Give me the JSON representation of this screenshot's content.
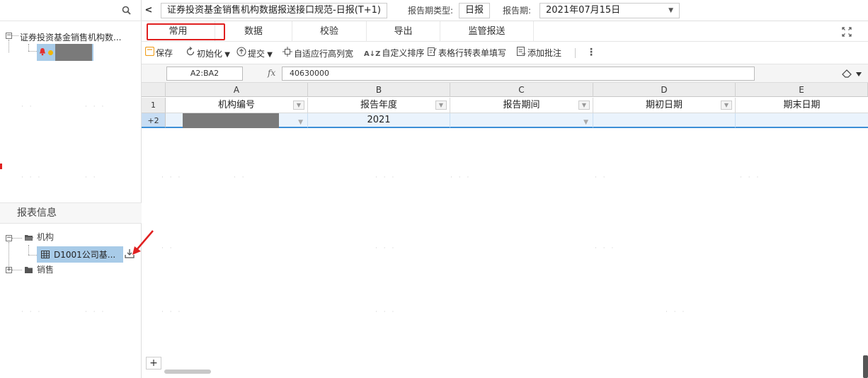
{
  "sidebar": {
    "tree_root_label": "证券投资基金销售机构数...",
    "section_title": "报表信息",
    "folders": [
      {
        "label": "机构",
        "expanded": true
      },
      {
        "label": "销售",
        "expanded": false
      }
    ],
    "report_item_label": "D1001公司基..."
  },
  "topbar": {
    "report_title": "证券投资基金销售机构数据报送接口规范-日报(T+1)",
    "period_type_label": "报告期类型:",
    "period_type_value": "日报",
    "period_label": "报告期:",
    "period_value": "2021年07月15日"
  },
  "tabs": [
    {
      "label": "常用",
      "active": true
    },
    {
      "label": "数据"
    },
    {
      "label": "校验"
    },
    {
      "label": "导出"
    },
    {
      "label": "监管报送"
    }
  ],
  "toolbar": {
    "save": "保存",
    "init": "初始化",
    "submit": "提交",
    "fit_row_col": "自适应行高列宽",
    "custom_sort": "自定义排序",
    "row_to_form": "表格行转表单填写",
    "add_comment": "添加批注"
  },
  "formula_bar": {
    "cell_ref": "A2:BA2",
    "fx_label": "fx",
    "value": "40630000"
  },
  "grid": {
    "columns": [
      "A",
      "B",
      "C",
      "D",
      "E"
    ],
    "row_labels": [
      "1",
      "+2"
    ],
    "header_row": [
      "机构编号",
      "报告年度",
      "报告期间",
      "期初日期",
      "期末日期"
    ],
    "data_row": [
      "",
      "2021",
      "",
      "",
      ""
    ]
  },
  "colors": {
    "highlight_red": "#e02020",
    "selection_blue": "#3d8fd6",
    "tree_selected": "#a8cbe8"
  }
}
